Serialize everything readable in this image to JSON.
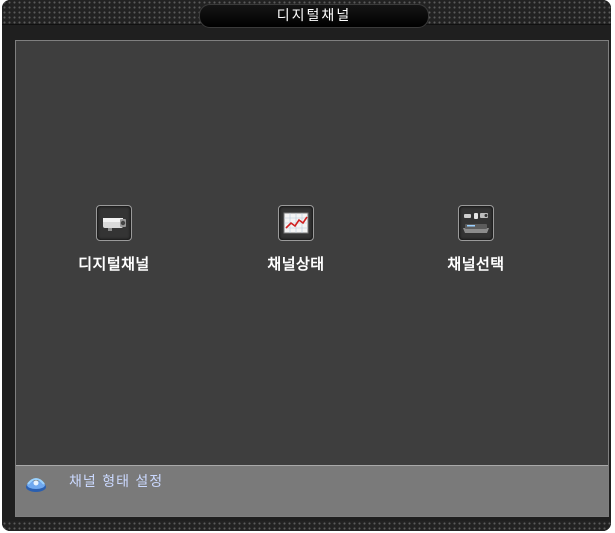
{
  "window": {
    "title": "디지털채널"
  },
  "menu": {
    "items": [
      {
        "label": "디지털채널",
        "icon": "camera-icon"
      },
      {
        "label": "채널상태",
        "icon": "chart-icon"
      },
      {
        "label": "채널선택",
        "icon": "devices-icon"
      }
    ]
  },
  "status": {
    "text": "채널 형태 설정",
    "icon": "network-icon"
  }
}
